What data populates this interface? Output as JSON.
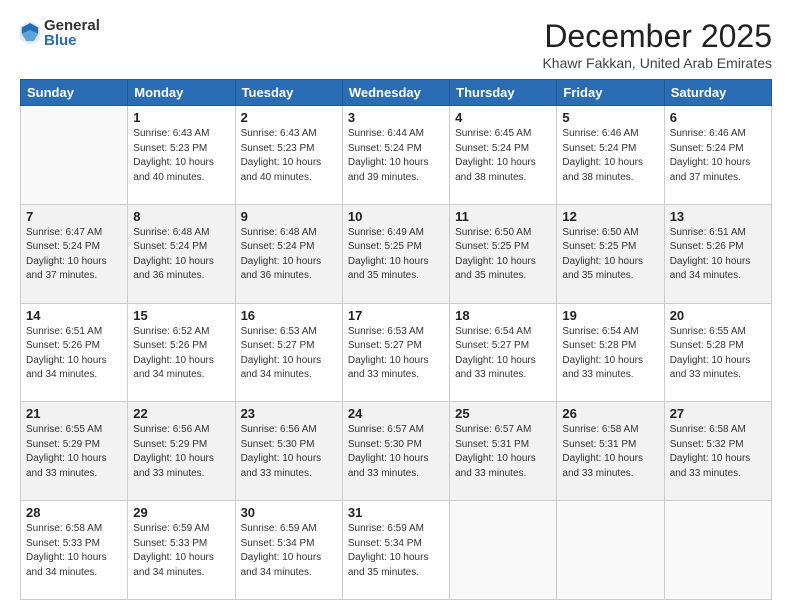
{
  "logo": {
    "general": "General",
    "blue": "Blue"
  },
  "title": "December 2025",
  "subtitle": "Khawr Fakkan, United Arab Emirates",
  "days_header": [
    "Sunday",
    "Monday",
    "Tuesday",
    "Wednesday",
    "Thursday",
    "Friday",
    "Saturday"
  ],
  "weeks": [
    [
      {
        "day": "",
        "info": ""
      },
      {
        "day": "1",
        "info": "Sunrise: 6:43 AM\nSunset: 5:23 PM\nDaylight: 10 hours\nand 40 minutes."
      },
      {
        "day": "2",
        "info": "Sunrise: 6:43 AM\nSunset: 5:23 PM\nDaylight: 10 hours\nand 40 minutes."
      },
      {
        "day": "3",
        "info": "Sunrise: 6:44 AM\nSunset: 5:24 PM\nDaylight: 10 hours\nand 39 minutes."
      },
      {
        "day": "4",
        "info": "Sunrise: 6:45 AM\nSunset: 5:24 PM\nDaylight: 10 hours\nand 38 minutes."
      },
      {
        "day": "5",
        "info": "Sunrise: 6:46 AM\nSunset: 5:24 PM\nDaylight: 10 hours\nand 38 minutes."
      },
      {
        "day": "6",
        "info": "Sunrise: 6:46 AM\nSunset: 5:24 PM\nDaylight: 10 hours\nand 37 minutes."
      }
    ],
    [
      {
        "day": "7",
        "info": "Sunrise: 6:47 AM\nSunset: 5:24 PM\nDaylight: 10 hours\nand 37 minutes."
      },
      {
        "day": "8",
        "info": "Sunrise: 6:48 AM\nSunset: 5:24 PM\nDaylight: 10 hours\nand 36 minutes."
      },
      {
        "day": "9",
        "info": "Sunrise: 6:48 AM\nSunset: 5:24 PM\nDaylight: 10 hours\nand 36 minutes."
      },
      {
        "day": "10",
        "info": "Sunrise: 6:49 AM\nSunset: 5:25 PM\nDaylight: 10 hours\nand 35 minutes."
      },
      {
        "day": "11",
        "info": "Sunrise: 6:50 AM\nSunset: 5:25 PM\nDaylight: 10 hours\nand 35 minutes."
      },
      {
        "day": "12",
        "info": "Sunrise: 6:50 AM\nSunset: 5:25 PM\nDaylight: 10 hours\nand 35 minutes."
      },
      {
        "day": "13",
        "info": "Sunrise: 6:51 AM\nSunset: 5:26 PM\nDaylight: 10 hours\nand 34 minutes."
      }
    ],
    [
      {
        "day": "14",
        "info": "Sunrise: 6:51 AM\nSunset: 5:26 PM\nDaylight: 10 hours\nand 34 minutes."
      },
      {
        "day": "15",
        "info": "Sunrise: 6:52 AM\nSunset: 5:26 PM\nDaylight: 10 hours\nand 34 minutes."
      },
      {
        "day": "16",
        "info": "Sunrise: 6:53 AM\nSunset: 5:27 PM\nDaylight: 10 hours\nand 34 minutes."
      },
      {
        "day": "17",
        "info": "Sunrise: 6:53 AM\nSunset: 5:27 PM\nDaylight: 10 hours\nand 33 minutes."
      },
      {
        "day": "18",
        "info": "Sunrise: 6:54 AM\nSunset: 5:27 PM\nDaylight: 10 hours\nand 33 minutes."
      },
      {
        "day": "19",
        "info": "Sunrise: 6:54 AM\nSunset: 5:28 PM\nDaylight: 10 hours\nand 33 minutes."
      },
      {
        "day": "20",
        "info": "Sunrise: 6:55 AM\nSunset: 5:28 PM\nDaylight: 10 hours\nand 33 minutes."
      }
    ],
    [
      {
        "day": "21",
        "info": "Sunrise: 6:55 AM\nSunset: 5:29 PM\nDaylight: 10 hours\nand 33 minutes."
      },
      {
        "day": "22",
        "info": "Sunrise: 6:56 AM\nSunset: 5:29 PM\nDaylight: 10 hours\nand 33 minutes."
      },
      {
        "day": "23",
        "info": "Sunrise: 6:56 AM\nSunset: 5:30 PM\nDaylight: 10 hours\nand 33 minutes."
      },
      {
        "day": "24",
        "info": "Sunrise: 6:57 AM\nSunset: 5:30 PM\nDaylight: 10 hours\nand 33 minutes."
      },
      {
        "day": "25",
        "info": "Sunrise: 6:57 AM\nSunset: 5:31 PM\nDaylight: 10 hours\nand 33 minutes."
      },
      {
        "day": "26",
        "info": "Sunrise: 6:58 AM\nSunset: 5:31 PM\nDaylight: 10 hours\nand 33 minutes."
      },
      {
        "day": "27",
        "info": "Sunrise: 6:58 AM\nSunset: 5:32 PM\nDaylight: 10 hours\nand 33 minutes."
      }
    ],
    [
      {
        "day": "28",
        "info": "Sunrise: 6:58 AM\nSunset: 5:33 PM\nDaylight: 10 hours\nand 34 minutes."
      },
      {
        "day": "29",
        "info": "Sunrise: 6:59 AM\nSunset: 5:33 PM\nDaylight: 10 hours\nand 34 minutes."
      },
      {
        "day": "30",
        "info": "Sunrise: 6:59 AM\nSunset: 5:34 PM\nDaylight: 10 hours\nand 34 minutes."
      },
      {
        "day": "31",
        "info": "Sunrise: 6:59 AM\nSunset: 5:34 PM\nDaylight: 10 hours\nand 35 minutes."
      },
      {
        "day": "",
        "info": ""
      },
      {
        "day": "",
        "info": ""
      },
      {
        "day": "",
        "info": ""
      }
    ]
  ]
}
